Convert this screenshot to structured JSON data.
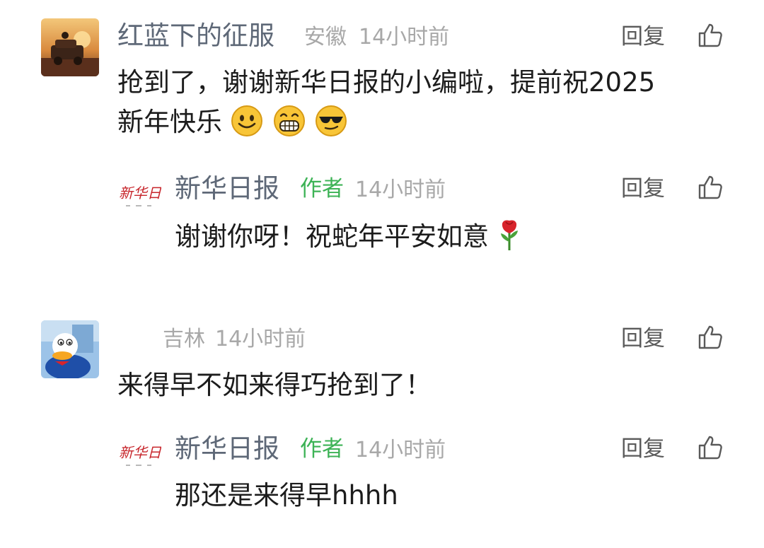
{
  "comments": [
    {
      "username": "红蓝下的征服",
      "location": "安徽",
      "time": "14小时前",
      "reply_label": "回复",
      "text_line1": "抢到了，谢谢新华日报的小编啦，提前祝2025",
      "text_line2": "新年快乐",
      "emojis": [
        "smile-emoji",
        "grin-emoji",
        "sunglasses-emoji"
      ],
      "reply": {
        "username": "新华日报",
        "badge": "作者",
        "time": "14小时前",
        "reply_label": "回复",
        "text": "谢谢你呀！祝蛇年平安如意",
        "emoji": "rose-emoji"
      }
    },
    {
      "username": "",
      "location": "吉林",
      "time": "14小时前",
      "reply_label": "回复",
      "text": "来得早不如来得巧抢到了！",
      "reply": {
        "username": "新华日报",
        "badge": "作者",
        "time": "14小时前",
        "reply_label": "回复",
        "text": "那还是来得早hhhh"
      }
    }
  ],
  "icons": {
    "like": "thumbs-up-icon",
    "avatar_1": "sunset-car-avatar",
    "avatar_2": "donald-duck-avatar",
    "author_logo": "xinhua-daily-logo"
  },
  "colors": {
    "username": "#5e6877",
    "meta": "#a8a8a8",
    "author_badge": "#3db356",
    "text": "#1c1c1c"
  }
}
